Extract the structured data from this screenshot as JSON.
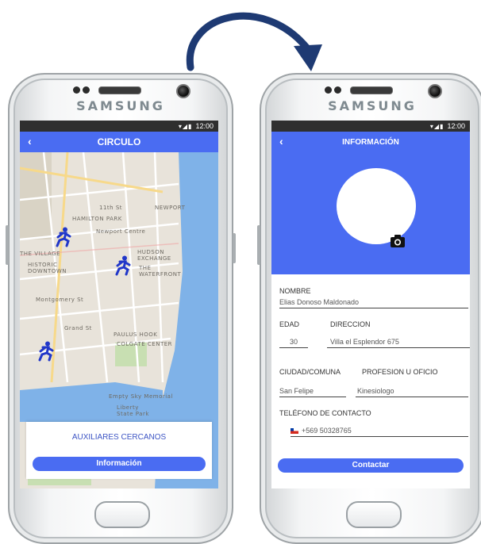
{
  "colors": {
    "accent": "#4a6cf2",
    "status_bar": "#2f2f2f",
    "arrow": "#1e3a73"
  },
  "device": {
    "brand": "SAMSUNG",
    "status_time": "12:00",
    "status_icons": "▾◢▮"
  },
  "map_screen": {
    "back_icon": "chevron-left-icon",
    "title": "CIRCULO",
    "map_labels": {
      "hamilton_park": "HAMILTON PARK",
      "newport": "NEWPORT",
      "newport_centre": "Newport Centre",
      "village": "THE VILLAGE",
      "historic_downtown": "HISTORIC\nDOWNTOWN",
      "hudson_exchange": "HUDSON\nEXCHANGE",
      "the_waterfront": "THE\nWATERFRONT",
      "paulus_hook": "PAULUS HOOK",
      "colgate_center": "COLGATE CENTER",
      "montgomery": "Montgomery St",
      "grand_st": "Grand St",
      "eleventh_st": "11th St",
      "empire_sky": "Empty Sky Memorial",
      "liberty_park": "Liberty\nState Park"
    },
    "card": {
      "title": "AUXILIARES CERCANOS",
      "button_label": "Información"
    }
  },
  "info_screen": {
    "back_icon": "chevron-left-icon",
    "title": "INFORMACIÓN",
    "fields": {
      "nombre_label": "NOMBRE",
      "nombre_value": "Elias Donoso Maldonado",
      "edad_label": "EDAD",
      "direccion_label": "DIRECCION",
      "edad_value": "30",
      "direccion_value": "Villa el Esplendor 675",
      "ciudad_label": "CIUDAD/COMUNA",
      "profesion_label": "PROFESION U OFICIO",
      "ciudad_value": "San Felipe",
      "profesion_value": "Kinesiologo",
      "telefono_label": "TELÉFONO DE CONTACTO",
      "telefono_value": "+569 50328765"
    },
    "contact_button": "Contactar"
  }
}
